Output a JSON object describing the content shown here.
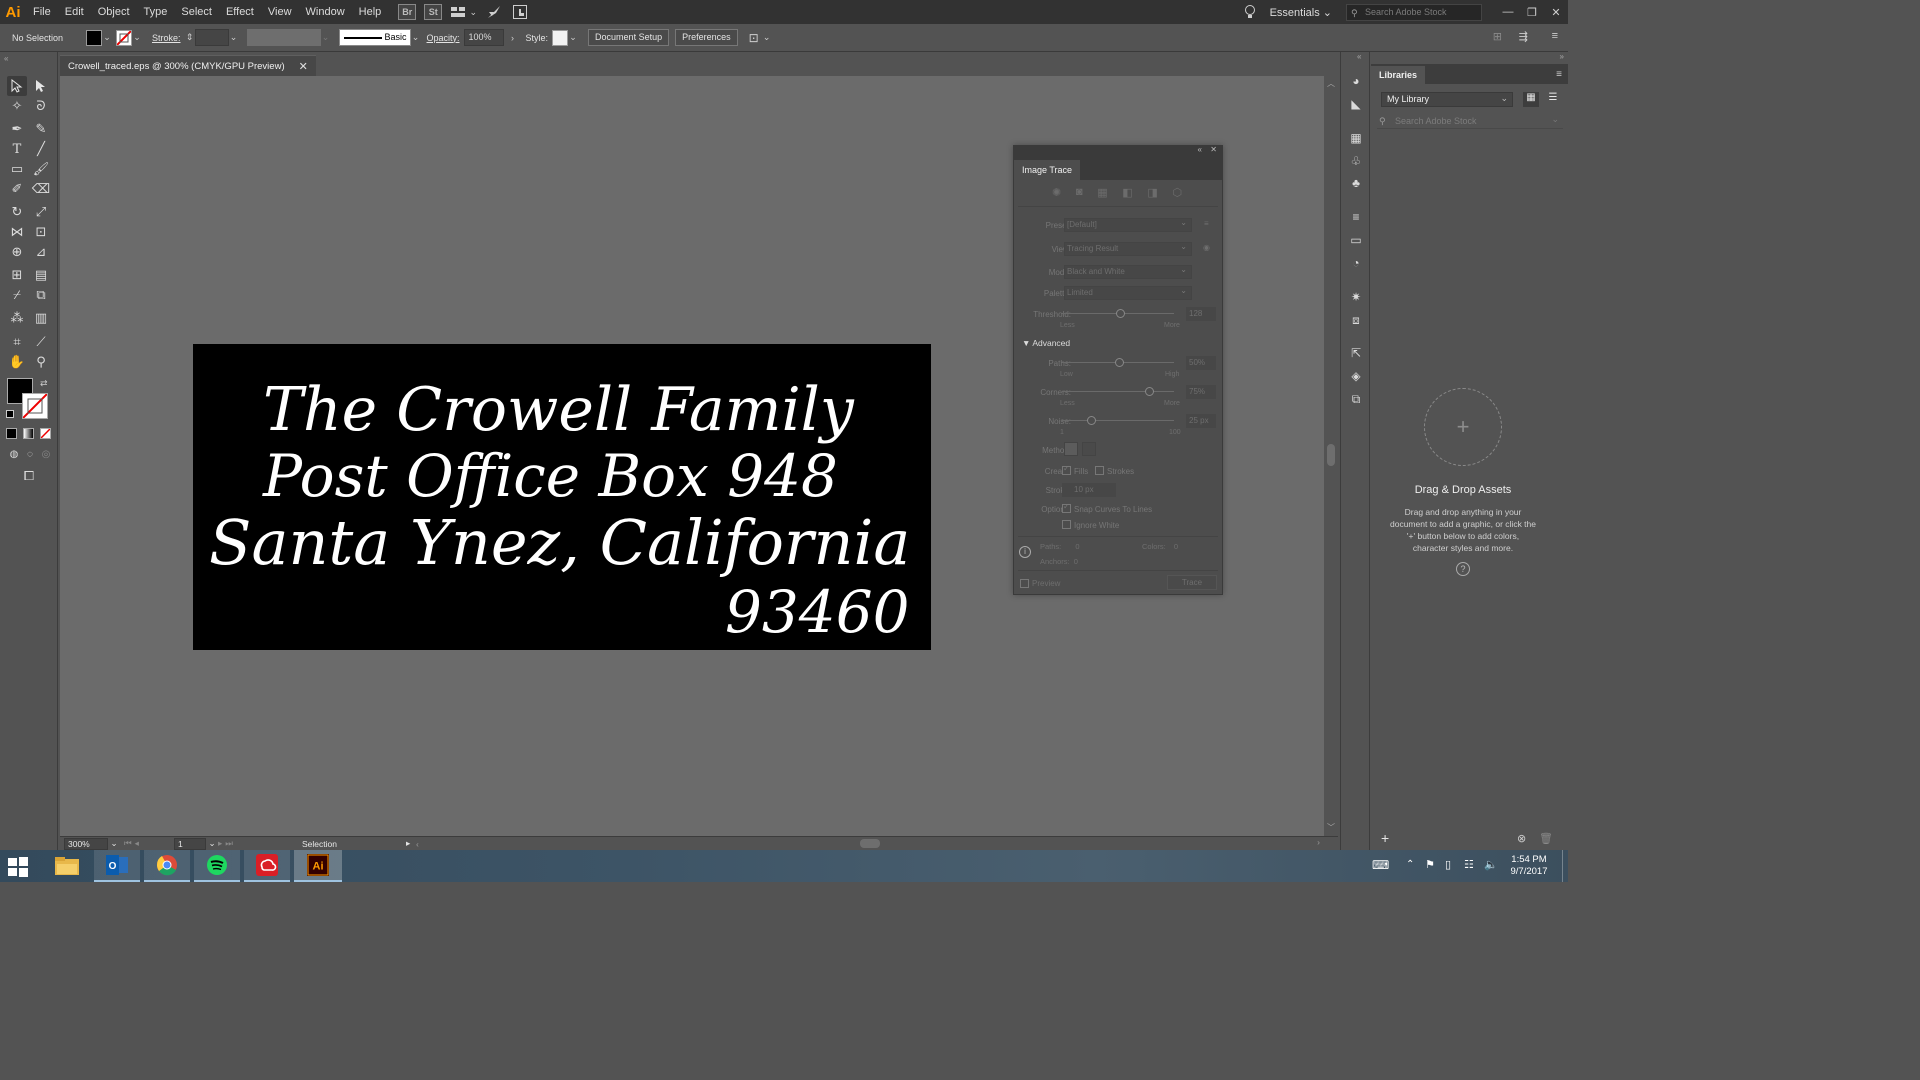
{
  "app": {
    "logo_text": "Ai"
  },
  "menu": [
    "File",
    "Edit",
    "Object",
    "Type",
    "Select",
    "Effect",
    "View",
    "Window",
    "Help"
  ],
  "menubar": {
    "bridge_label": "Br",
    "stock_label": "St",
    "workspace": "Essentials",
    "stock_search_placeholder": "Search Adobe Stock"
  },
  "control": {
    "selection_status": "No Selection",
    "stroke_label": "Stroke:",
    "brush_label": "Basic",
    "opacity_label": "Opacity:",
    "opacity_value": "100%",
    "style_label": "Style:",
    "document_setup": "Document Setup",
    "preferences": "Preferences"
  },
  "document_tab": {
    "title": "Crowell_traced.eps @ 300% (CMYK/GPU Preview)"
  },
  "artwork": {
    "line1": "The Crowell Family",
    "line2": "Post Office Box 948",
    "line3": "Santa Ynez, California",
    "line4": "93460"
  },
  "status": {
    "zoom": "300%",
    "artboard_number": "1",
    "tool_name": "Selection"
  },
  "image_trace": {
    "title": "Image Trace",
    "preset_label": "Preset:",
    "preset_value": "[Default]",
    "view_label": "View:",
    "view_value": "Tracing Result",
    "mode_label": "Mode:",
    "mode_value": "Black and White",
    "palette_label": "Palette:",
    "palette_value": "Limited",
    "threshold_label": "Threshold:",
    "threshold_value": "128",
    "threshold_min": "Less",
    "threshold_max": "More",
    "advanced_label": "Advanced",
    "paths_label": "Paths:",
    "paths_value": "50%",
    "paths_min": "Low",
    "paths_max": "High",
    "corners_label": "Corners:",
    "corners_value": "75%",
    "corners_min": "Less",
    "corners_max": "More",
    "noise_label": "Noise:",
    "noise_value": "25 px",
    "noise_min": "1",
    "noise_max": "100",
    "method_label": "Method:",
    "create_label": "Create:",
    "fills_label": "Fills",
    "strokes_label": "Strokes",
    "stroke_label": "Stroke:",
    "stroke_value": "10 px",
    "options_label": "Options:",
    "snap_label": "Snap Curves To Lines",
    "ignore_white_label": "Ignore White",
    "paths_count_label": "Paths:",
    "paths_count": "0",
    "colors_label": "Colors:",
    "colors_count": "0",
    "anchors_label": "Anchors:",
    "anchors_count": "0",
    "preview_label": "Preview",
    "trace_button": "Trace"
  },
  "libraries": {
    "tab": "Libraries",
    "library_name": "My Library",
    "search_placeholder": "Search Adobe Stock",
    "drop_title": "Drag & Drop Assets",
    "drop_desc": "Drag and drop anything in your document to add a graphic, or click the '+' button below to add colors, character styles and more."
  },
  "taskbar": {
    "time": "1:54 PM",
    "date": "9/7/2017",
    "apps": [
      "file-explorer",
      "outlook",
      "chrome",
      "spotify",
      "creative-cloud",
      "illustrator"
    ]
  },
  "colors": {
    "accent_illustrator": "#ff9a00",
    "canvas": "#6b6b6b",
    "artboard": "#000000",
    "lettering": "#ffffff"
  }
}
